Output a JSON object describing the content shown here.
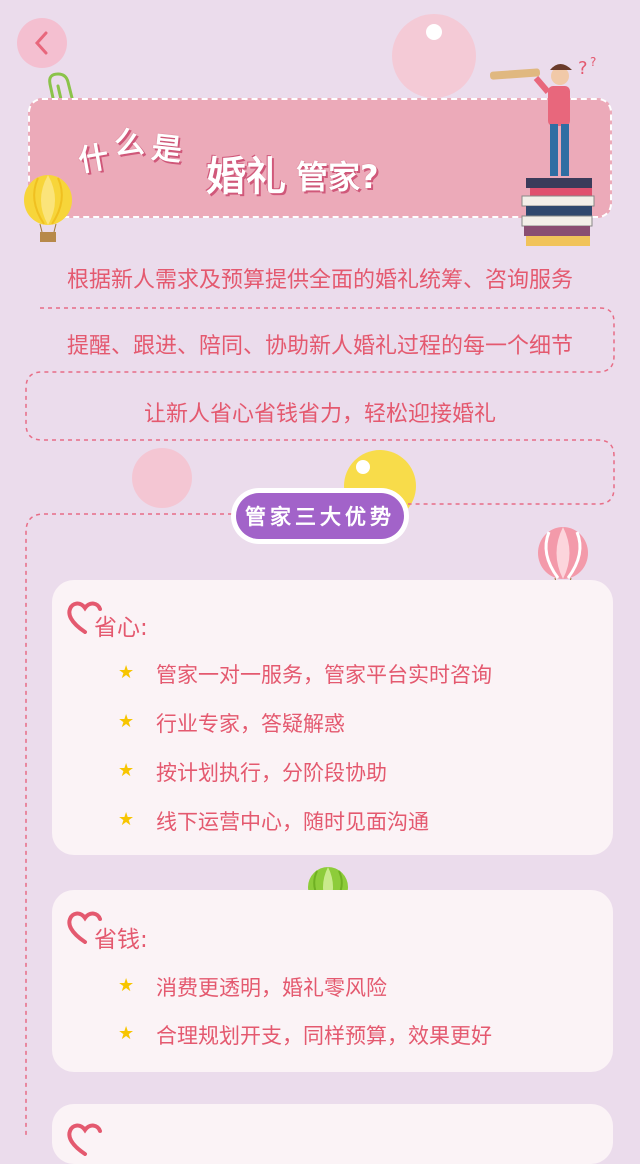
{
  "nav": {
    "back_icon": "chevron-left-icon"
  },
  "title": {
    "part1": "什",
    "part2": "么",
    "part3": "是",
    "part4": "婚礼",
    "part5": "管家?"
  },
  "intro": [
    "根据新人需求及预算提供全面的婚礼统筹、咨询服务",
    "提醒、跟进、陪同、协助新人婚礼过程的每一个细节",
    "让新人省心省钱省力，轻松迎接婚礼"
  ],
  "badge": {
    "label": "管家三大优势"
  },
  "cards": [
    {
      "title": "省心:",
      "items": [
        "管家一对一服务，管家平台实时咨询",
        "行业专家，答疑解惑",
        "按计划执行，分阶段协助",
        "线下运营中心，随时见面沟通"
      ]
    },
    {
      "title": "省钱:",
      "items": [
        "消费更透明，婚礼零风险",
        "合理规划开支，同样预算，效果更好"
      ]
    }
  ],
  "colors": {
    "background": "#ebdcec",
    "accent_pink": "#e4596f",
    "banner": "#ecaab9",
    "badge_purple": "#a263c9",
    "star_yellow": "#f7c500"
  }
}
